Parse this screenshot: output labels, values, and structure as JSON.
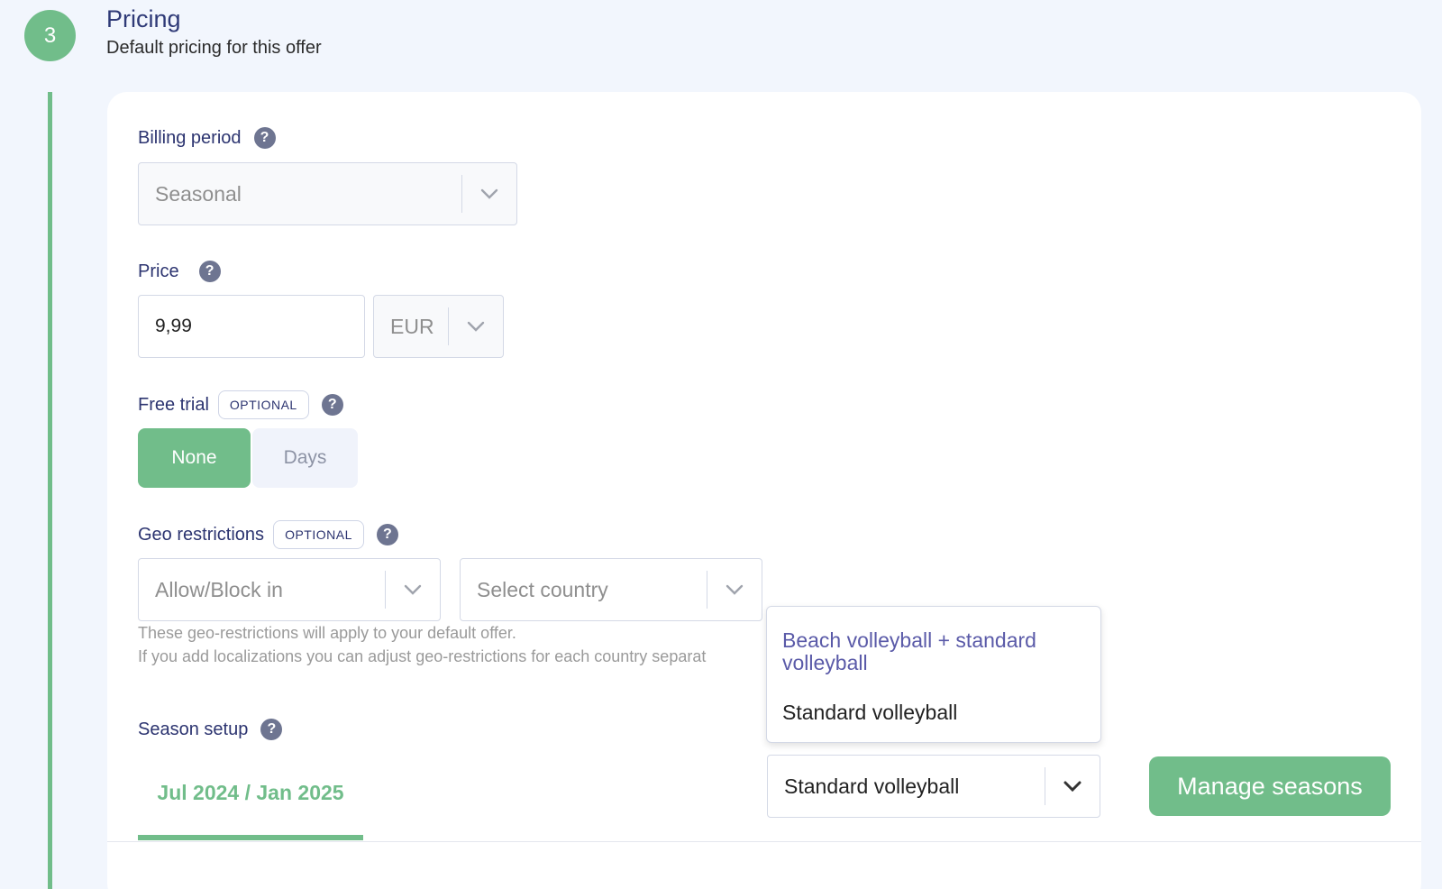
{
  "step": {
    "number": "3",
    "title": "Pricing",
    "subtitle": "Default pricing for this offer"
  },
  "billing_period": {
    "label": "Billing period",
    "value": "Seasonal"
  },
  "price": {
    "label": "Price",
    "amount": "9,99",
    "currency": "EUR"
  },
  "free_trial": {
    "label": "Free trial",
    "badge": "OPTIONAL",
    "options": [
      "None",
      "Days"
    ],
    "selected": "None"
  },
  "geo_restrictions": {
    "label": "Geo restrictions",
    "badge": "OPTIONAL",
    "mode_placeholder": "Allow/Block in",
    "country_placeholder": "Select country",
    "hint_line1": "These geo-restrictions will apply to your default offer.",
    "hint_line2": "If you add localizations you can adjust geo-restrictions for each country separat"
  },
  "season_setup": {
    "label": "Season setup",
    "tab": "Jul 2024 / Jan 2025",
    "selected_value": "Standard volleyball",
    "dropdown_options": [
      "Beach volleyball + standard volleyball",
      "Standard volleyball"
    ],
    "manage_button": "Manage seasons"
  },
  "colors": {
    "accent_green": "#71bd8a",
    "label_navy": "#2c3470",
    "highlight_purple": "#5a5aa8",
    "page_bg": "#f2f6fd"
  },
  "icons": {
    "help": "question-mark-circle",
    "chevron": "chevron-down"
  }
}
